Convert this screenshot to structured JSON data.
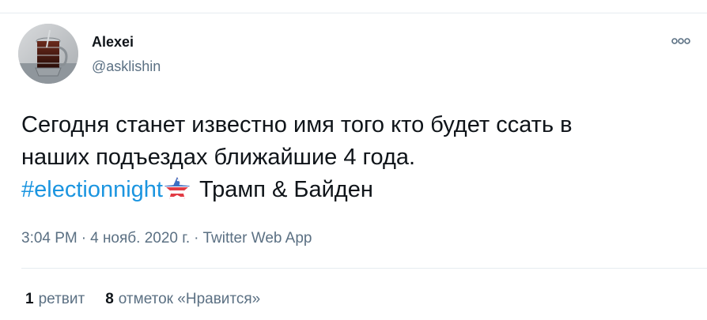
{
  "author": {
    "name": "Alexei",
    "handle": "@asklishin"
  },
  "menu": {
    "icon": "more-horizontal-icon"
  },
  "tweet": {
    "line1": "Сегодня станет известно имя того кто будет ссать в",
    "line2": "наших подъездах ближайшие 4 года.",
    "hashtag": "#electionnight",
    "hashtag_emoji_icon": "usa-star-icon",
    "line3_rest": "Трамп & Байден"
  },
  "meta": {
    "time": "3:04 PM",
    "separator": "·",
    "date": "4 нояб. 2020 г.",
    "source": "Twitter Web App"
  },
  "stats": {
    "retweets_count": "1",
    "retweets_label": "ретвит",
    "likes_count": "8",
    "likes_label": "отметок «Нравится»"
  },
  "colors": {
    "link": "#1b95e0",
    "secondary_text": "#5b7083",
    "primary_text": "#0f1419",
    "divider": "#e6ecf0"
  }
}
